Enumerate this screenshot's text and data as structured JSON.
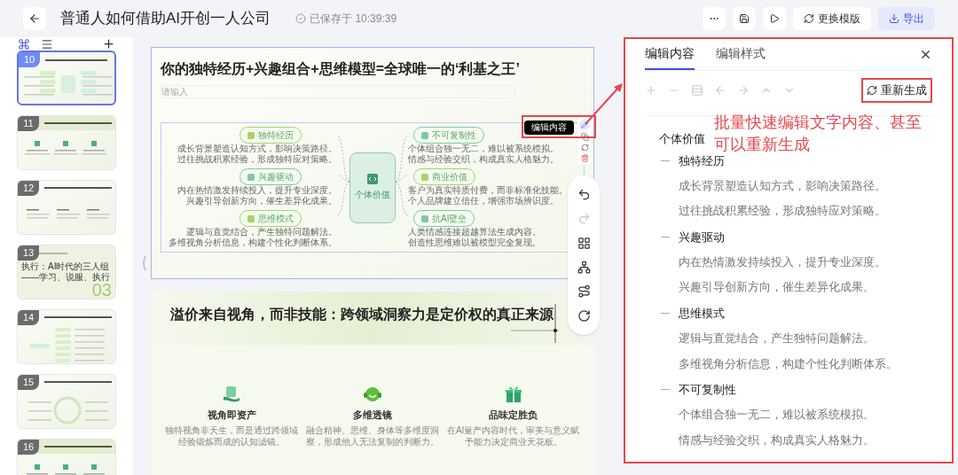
{
  "header": {
    "title": "普通人如何借助AI开创一人公司",
    "saved": "已保存于 10:39:39",
    "buttons": [
      {
        "kind": "more"
      },
      {
        "kind": "save"
      },
      {
        "kind": "play"
      },
      {
        "kind": "template",
        "label": "更换模版",
        "primary": false
      },
      {
        "kind": "export",
        "label": "导出",
        "primary": true
      }
    ]
  },
  "sidebar": {
    "slides": [
      {
        "number": "10",
        "kind": "mindmap",
        "selected": true
      },
      {
        "number": "11",
        "kind": "columns",
        "selected": false
      },
      {
        "number": "12",
        "kind": "text",
        "selected": false
      },
      {
        "number": "13",
        "kind": "section",
        "selected": false,
        "lines": [
          "执行：AI时代的三人组",
          "——学习、说服、执行"
        ],
        "big": "03"
      },
      {
        "number": "14",
        "kind": "list",
        "selected": false
      },
      {
        "number": "15",
        "kind": "cycle",
        "selected": false
      },
      {
        "number": "16",
        "kind": "columns",
        "selected": false
      }
    ]
  },
  "slides": [
    {
      "title": "你的独特经历+兴趣组合+思维模型=全球唯一的‘利基之王’",
      "subtitle_placeholder": "请输入",
      "mindmap": {
        "center": "个体价值",
        "left_branches": [
          {
            "label": "独特经历",
            "color": "#a5d46a",
            "lines": [
              "成长背景塑造认知方式，影响决策路径。",
              "过往挑战积累经验，形成独特应对策略。"
            ]
          },
          {
            "label": "兴趣驱动",
            "color": "#7cc9a6",
            "lines": [
              "内在热情激发持续投入，提升专业深度。",
              "兴趣引导创新方向，催生差异化成果。"
            ]
          },
          {
            "label": "思维模式",
            "color": "#a5d46a",
            "lines": [
              "逻辑与直觉结合，产生独特问题解法。",
              "多维视角分析信息，构建个性化判断体系。"
            ]
          }
        ],
        "right_branches": [
          {
            "label": "不可复制性",
            "color": "#7cc9a6",
            "lines": [
              "个体组合独一无二，难以被系统模拟。",
              "情感与经验交织，构成真实人格魅力。"
            ]
          },
          {
            "label": "商业价值",
            "color": "#a5d46a",
            "lines": [
              "客户为真实特质付费，而非标准化技能。",
              "个人品牌建立信任，增强市场辨识度。"
            ]
          },
          {
            "label": "抗AI壁垒",
            "color": "#7cc9a6",
            "lines": [
              "人类情感连接超越算法生成内容。",
              "创造性思维难以被模型完全复现。"
            ]
          }
        ]
      },
      "tooltip": "编辑内容"
    },
    {
      "title": "溢价来自视角，而非技能：跨领域洞察力是定价权的真正来源",
      "features": [
        {
          "kind": "hand",
          "title": "视角即资产",
          "text": "独特视角非天生，而是通过跨领域经验锻炼而成的认知滤镜。"
        },
        {
          "kind": "headset",
          "title": "多维透镜",
          "text": "融合精神、思维、身体等多维度洞察，形成他人无法复制的判断力。"
        },
        {
          "kind": "gift",
          "title": "品味定胜负",
          "text": "在AI量产内容时代，审美与意义赋予能力决定商业天花板。"
        }
      ]
    }
  ],
  "canvas_tools": [
    {
      "kind": "undo",
      "disabled": false
    },
    {
      "kind": "redo",
      "disabled": true
    },
    {
      "kind": "grid",
      "disabled": false
    },
    {
      "kind": "tree",
      "disabled": false
    },
    {
      "kind": "route",
      "disabled": false
    },
    {
      "kind": "refresh",
      "disabled": false
    }
  ],
  "editor": {
    "tabs": [
      {
        "label": "编辑内容",
        "selected": true
      },
      {
        "label": "编辑样式",
        "selected": false
      }
    ],
    "tools": [
      {
        "kind": "add",
        "disabled": true
      },
      {
        "kind": "remove",
        "disabled": true
      },
      {
        "kind": "node",
        "disabled": true
      },
      {
        "kind": "outdent",
        "disabled": true
      },
      {
        "kind": "indent",
        "disabled": true
      },
      {
        "kind": "up",
        "disabled": true
      },
      {
        "kind": "down",
        "disabled": true
      }
    ],
    "regenerate": "重新生成",
    "outline": {
      "root": "个体价值",
      "children": [
        {
          "label": "独特经历",
          "children": [
            "成长背景塑造认知方式，影响决策路径。",
            "过往挑战积累经验，形成独特应对策略。"
          ]
        },
        {
          "label": "兴趣驱动",
          "children": [
            "内在热情激发持续投入，提升专业深度。",
            "兴趣引导创新方向，催生差异化成果。"
          ]
        },
        {
          "label": "思维模式",
          "children": [
            "逻辑与直觉结合，产生独特问题解法。",
            "多维视角分析信息，构建个性化判断体系。"
          ]
        },
        {
          "label": "不可复制性",
          "children": [
            "个体组合独一无二，难以被系统模拟。",
            "情感与经验交织，构成真实人格魅力。"
          ]
        }
      ]
    }
  },
  "annotation": "批量快速编辑文字内容、甚至可以重新生成"
}
